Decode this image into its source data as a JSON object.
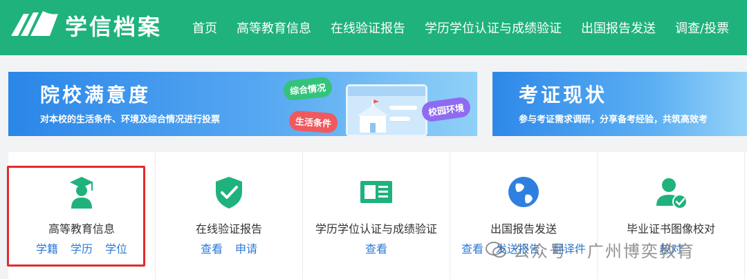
{
  "header": {
    "brand": "学信档案",
    "nav": [
      "首页",
      "高等教育信息",
      "在线验证报告",
      "学历学位认证与成绩验证",
      "出国报告发送",
      "调查/投票"
    ],
    "bg_color": "#1fb27c"
  },
  "banners": [
    {
      "title": "院校满意度",
      "subtitle": "对本校的生活条件、环境及综合情况进行投票",
      "tags": [
        "综合情况",
        "生活条件",
        "校园环境"
      ]
    },
    {
      "title": "考证现状",
      "subtitle": "参与考证需求调研，分享备考经验，共筑高效考"
    }
  ],
  "services": [
    {
      "icon": "graduate-icon",
      "label": "高等教育信息",
      "links": [
        "学籍",
        "学历",
        "学位"
      ]
    },
    {
      "icon": "shield-check-icon",
      "label": "在线验证报告",
      "links": [
        "查看",
        "申请"
      ]
    },
    {
      "icon": "id-card-icon",
      "label": "学历学位认证与成绩验证",
      "links": [
        "查看"
      ]
    },
    {
      "icon": "globe-icon",
      "label": "出国报告发送",
      "links": [
        "查看",
        "发送报告",
        "翻译件"
      ]
    },
    {
      "icon": "user-check-icon",
      "label": "毕业证书图像校对",
      "links": [
        "校对"
      ]
    }
  ],
  "watermark": {
    "text": "公众号 · 广州博奕教育"
  },
  "colors": {
    "accent": "#1fb27c",
    "link": "#2c7ad6",
    "highlight": "#e22b2b"
  }
}
